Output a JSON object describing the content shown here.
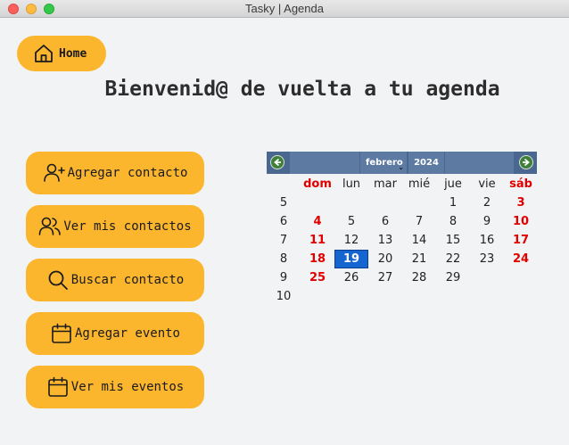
{
  "window": {
    "title": "Tasky | Agenda"
  },
  "home": {
    "label": "Home"
  },
  "headline": "Bienvenid@ de vuelta a tu agenda",
  "actions": [
    {
      "label": "Agregar contacto",
      "icon": "user-plus-icon"
    },
    {
      "label": "Ver mis contactos",
      "icon": "users-icon"
    },
    {
      "label": "Buscar contacto",
      "icon": "search-icon"
    },
    {
      "label": "Agregar evento",
      "icon": "calendar-icon"
    },
    {
      "label": "Ver mis eventos",
      "icon": "calendar-icon"
    }
  ],
  "calendar": {
    "month": "febrero",
    "year": "2024",
    "weekdays": [
      "dom",
      "lun",
      "mar",
      "mié",
      "jue",
      "vie",
      "sáb"
    ],
    "selected_day": "19",
    "weeks": [
      {
        "week": "5",
        "days": [
          "",
          "",
          "",
          "",
          "1",
          "2",
          "3"
        ]
      },
      {
        "week": "6",
        "days": [
          "4",
          "5",
          "6",
          "7",
          "8",
          "9",
          "10"
        ]
      },
      {
        "week": "7",
        "days": [
          "11",
          "12",
          "13",
          "14",
          "15",
          "16",
          "17"
        ]
      },
      {
        "week": "8",
        "days": [
          "18",
          "19",
          "20",
          "21",
          "22",
          "23",
          "24"
        ]
      },
      {
        "week": "9",
        "days": [
          "25",
          "26",
          "27",
          "28",
          "29",
          "",
          ""
        ]
      },
      {
        "week": "10",
        "days": [
          "",
          "",
          "",
          "",
          "",
          "",
          ""
        ]
      }
    ]
  },
  "colors": {
    "button": "#fbb62e",
    "calendar_header": "#4a6790",
    "weekend": "#e00000",
    "selected": "#1465d0"
  }
}
